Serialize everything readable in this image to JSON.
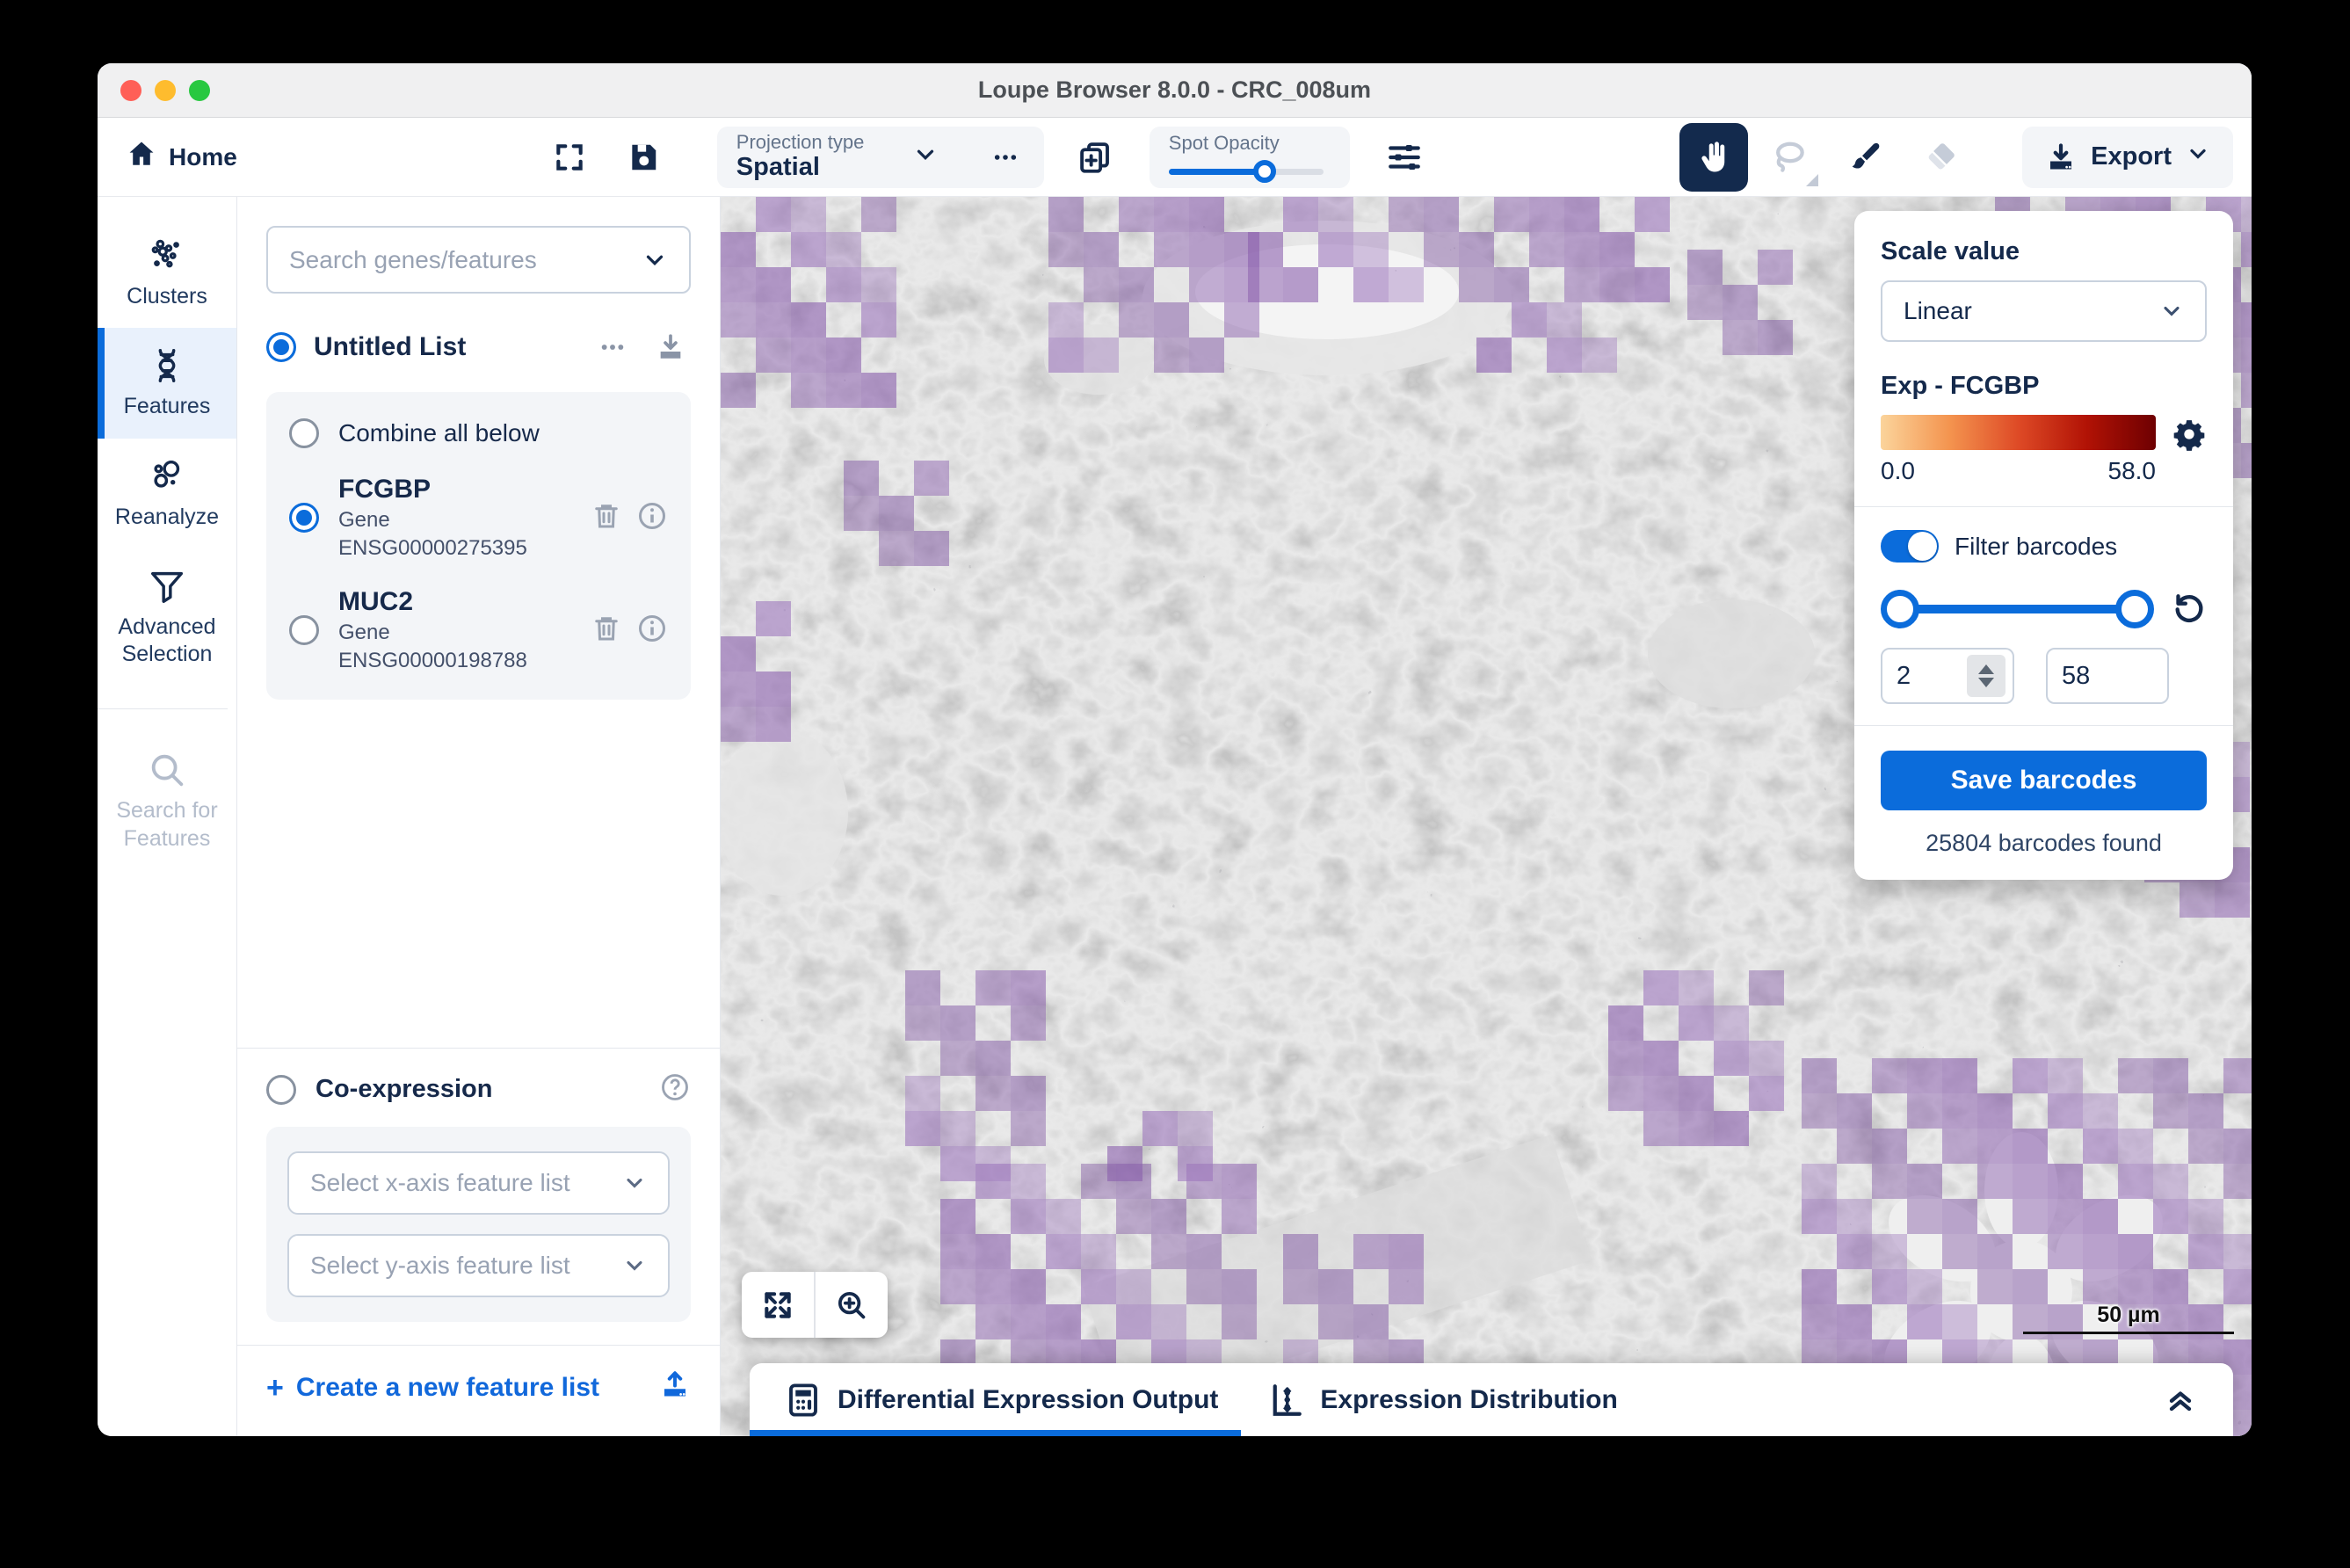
{
  "window": {
    "title": "Loupe Browser 8.0.0 - CRC_008um"
  },
  "toolbar": {
    "home_label": "Home",
    "projection_label": "Projection type",
    "projection_value": "Spatial",
    "spot_opacity_label": "Spot Opacity",
    "export_label": "Export"
  },
  "sidebar": {
    "items": [
      {
        "label": "Clusters"
      },
      {
        "label": "Features"
      },
      {
        "label": "Reanalyze"
      },
      {
        "label": "Advanced Selection"
      },
      {
        "label": "Search for Features"
      }
    ]
  },
  "features_panel": {
    "search_placeholder": "Search genes/features",
    "list_name": "Untitled List",
    "combine_label": "Combine all below",
    "items": [
      {
        "name": "FCGBP",
        "type": "Gene",
        "id": "ENSG00000275395"
      },
      {
        "name": "MUC2",
        "type": "Gene",
        "id": "ENSG00000198788"
      }
    ],
    "coexpression_label": "Co-expression",
    "x_select_placeholder": "Select x-axis feature list",
    "y_select_placeholder": "Select y-axis feature list",
    "create_label": "Create a new feature list"
  },
  "scale_panel": {
    "scale_value_label": "Scale value",
    "scale_type": "Linear",
    "exp_label": "Exp - FCGBP",
    "range_min": "0.0",
    "range_max": "58.0",
    "filter_label": "Filter barcodes",
    "filter_min_value": "2",
    "filter_max_value": "58",
    "save_button_label": "Save barcodes",
    "barcodes_found": "25804 barcodes found",
    "gradient": [
      "#FBD49B",
      "#F4944F",
      "#DE4A26",
      "#B11205",
      "#6E0001"
    ],
    "accent": "#0B6CDB"
  },
  "viewer": {
    "scalebar_label": "50 µm"
  },
  "bottom_bar": {
    "tabs": [
      {
        "label": "Differential Expression Output"
      },
      {
        "label": "Expression Distribution"
      }
    ]
  }
}
